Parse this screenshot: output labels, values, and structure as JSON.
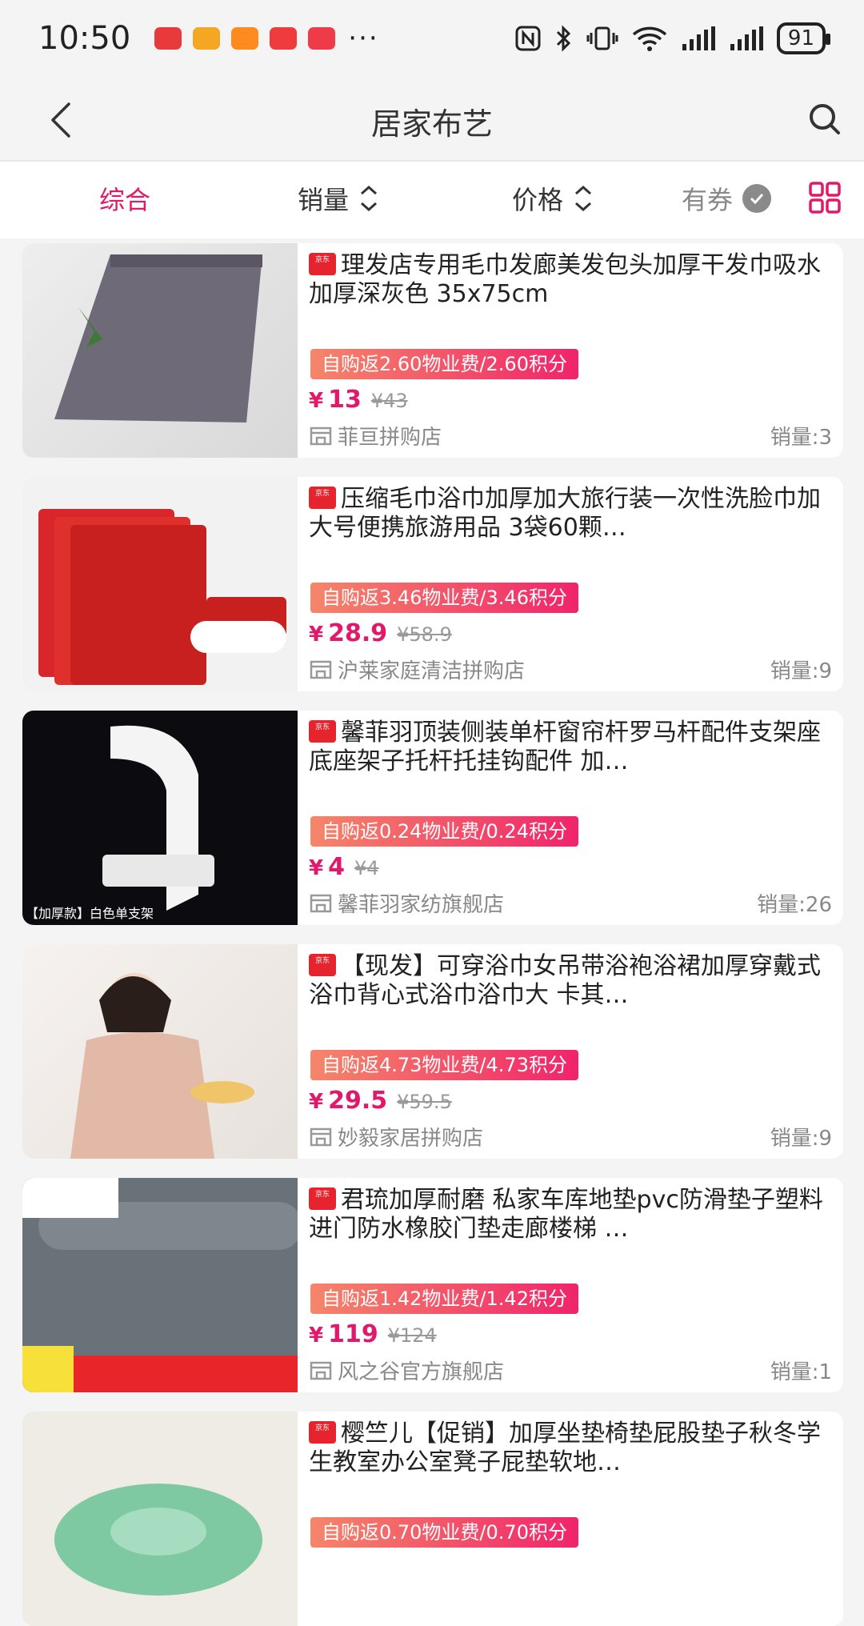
{
  "status": {
    "time": "10:50",
    "dots": "···",
    "battery": "91",
    "apps": [
      {
        "name": "huawei-app",
        "color": "#e83a3a"
      },
      {
        "name": "weibo-app",
        "color": "#f5a623"
      },
      {
        "name": "game-app",
        "color": "#ff8a1e"
      },
      {
        "name": "message-app",
        "color": "#ef3b3b"
      },
      {
        "name": "huawei-store-app",
        "color": "#ee3b47"
      }
    ]
  },
  "nav": {
    "title": "居家布艺"
  },
  "filters": {
    "overall": "综合",
    "sales": "销量",
    "price": "价格",
    "coupon": "有券"
  },
  "colors": {
    "accent": "#e2196a"
  },
  "products": [
    {
      "title": "理发店专用毛巾发廊美发包头加厚干发巾吸水 加厚深灰色 35x75cm",
      "rebate": "自购返2.60物业费/2.60积分",
      "price": "13",
      "original": "¥43",
      "store": "菲亘拼购店",
      "sales": "销量:3",
      "thumb_caption": ""
    },
    {
      "title": "压缩毛巾浴巾加厚加大旅行装一次性洗脸巾加大号便携旅游用品 3袋60颗…",
      "rebate": "自购返3.46物业费/3.46积分",
      "price": "28.9",
      "original": "¥58.9",
      "store": "沪莱家庭清洁拼购店",
      "sales": "销量:9",
      "thumb_caption": ""
    },
    {
      "title": "馨菲羽顶装侧装单杆窗帘杆罗马杆配件支架座底座架子托杆托挂钩配件 加…",
      "rebate": "自购返0.24物业费/0.24积分",
      "price": "4",
      "original": "¥4",
      "store": "馨菲羽家纺旗舰店",
      "sales": "销量:26",
      "thumb_caption": "【加厚款】白色单支架"
    },
    {
      "title": "【现发】可穿浴巾女吊带浴袍浴裙加厚穿戴式浴巾背心式浴巾浴巾大 卡其…",
      "rebate": "自购返4.73物业费/4.73积分",
      "price": "29.5",
      "original": "¥59.5",
      "store": "妙毅家居拼购店",
      "sales": "销量:9",
      "thumb_caption": ""
    },
    {
      "title": "君琉加厚耐磨 私家车库地垫pvc防滑垫子塑料进门防水橡胶门垫走廊楼梯 …",
      "rebate": "自购返1.42物业费/1.42积分",
      "price": "119",
      "original": "¥124",
      "store": "风之谷官方旗舰店",
      "sales": "销量:1",
      "thumb_caption": ""
    },
    {
      "title": "樱竺儿【促销】加厚坐垫椅垫屁股垫子秋冬学生教室办公室凳子屁垫软地…",
      "rebate": "自购返0.70物业费/0.70积分",
      "price": "",
      "original": "",
      "store": "",
      "sales": "",
      "thumb_caption": ""
    }
  ]
}
